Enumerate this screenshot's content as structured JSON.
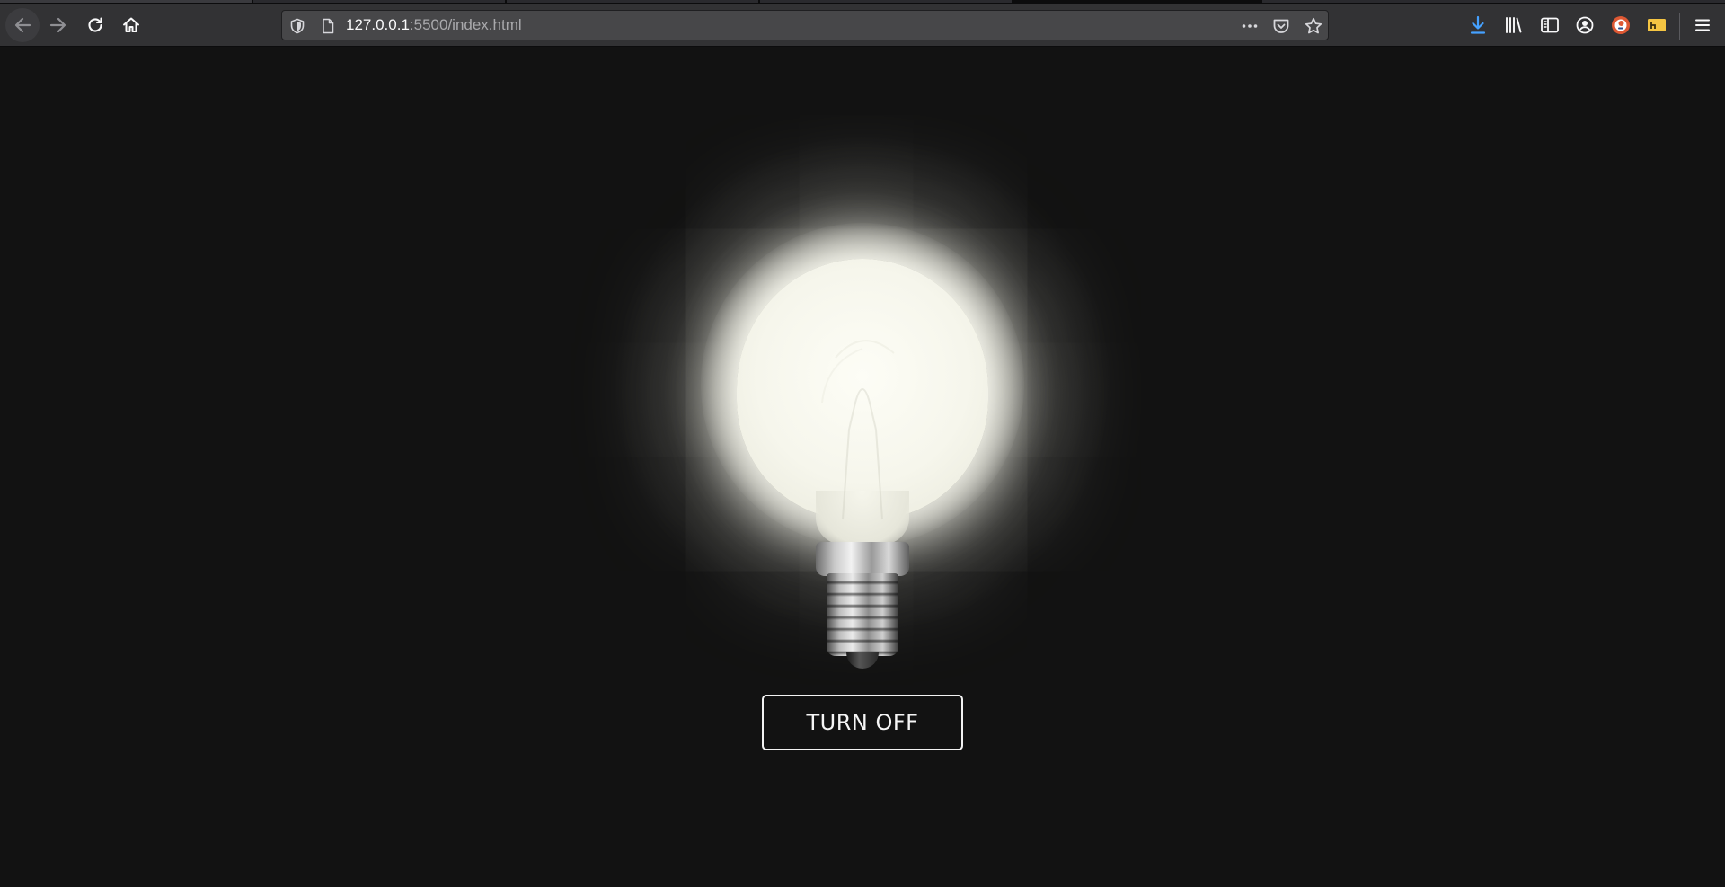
{
  "browser": {
    "url_host": "127.0.0.1",
    "url_rest": ":5500/index.html",
    "icons": {
      "back": "arrow-left-icon",
      "forward": "arrow-right-icon",
      "reload": "reload-icon",
      "home": "home-icon",
      "tracking": "shield-icon",
      "page": "page-icon",
      "page_actions": "more-dots-icon",
      "pocket": "pocket-icon",
      "bookmark": "star-icon",
      "downloads": "download-icon",
      "library": "library-icon",
      "sidebar": "sidebar-icon",
      "account": "account-icon",
      "duckduckgo": "duckduckgo-icon",
      "extension": "extension-icon",
      "menu": "hamburger-menu-icon"
    },
    "colors": {
      "toolbar": "#323234",
      "urlbar": "#474749",
      "download_accent": "#45a1ff",
      "duckduckgo_accent": "#de5833",
      "extension_accent": "#f5c542"
    }
  },
  "page": {
    "bulb_state": "on",
    "button_label": "TURN OFF",
    "colors": {
      "background": "#121212",
      "glow": "#fcfcf3",
      "button_border": "#f2f2f2"
    }
  }
}
